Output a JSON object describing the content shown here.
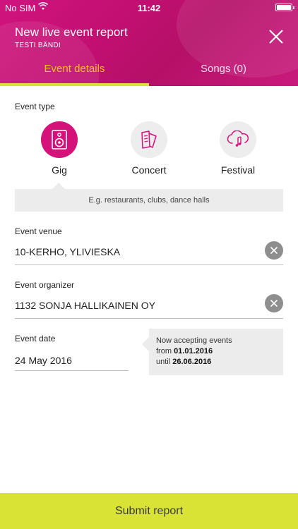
{
  "status_bar": {
    "carrier": "No SIM",
    "time": "11:42",
    "wifi_icon": "wifi-icon",
    "battery_icon": "battery-icon"
  },
  "header": {
    "title": "New live event report",
    "subtitle": "TESTI BÄNDI",
    "close_icon": "close-icon",
    "background_color": "#c8137a"
  },
  "tabs": [
    {
      "label": "Event details",
      "active": true,
      "color": "#f2c31a"
    },
    {
      "label": "Songs (0)",
      "active": false
    }
  ],
  "event_type": {
    "label": "Event type",
    "options": [
      {
        "label": "Gig",
        "icon": "speaker-icon",
        "selected": true
      },
      {
        "label": "Concert",
        "icon": "ticket-icon",
        "selected": false
      },
      {
        "label": "Festival",
        "icon": "cloud-music-icon",
        "selected": false
      }
    ],
    "hint": "E.g. restaurants, clubs, dance halls"
  },
  "venue": {
    "label": "Event venue",
    "value": "10-KERHO, YLIVIESKA"
  },
  "organizer": {
    "label": "Event organizer",
    "value": "1132 SONJA HALLIKAINEN OY"
  },
  "date": {
    "label": "Event date",
    "value": "24 May 2016",
    "info_line1": "Now accepting events",
    "info_from_prefix": "from",
    "info_from_date": "01.01.2016",
    "info_until_prefix": "until",
    "info_until_date": "26.06.2016"
  },
  "submit": {
    "label": "Submit report",
    "color": "#d8e336"
  },
  "colors": {
    "accent": "#d5127a",
    "tab_active": "#f2c31a",
    "lime": "#d7e33a"
  }
}
